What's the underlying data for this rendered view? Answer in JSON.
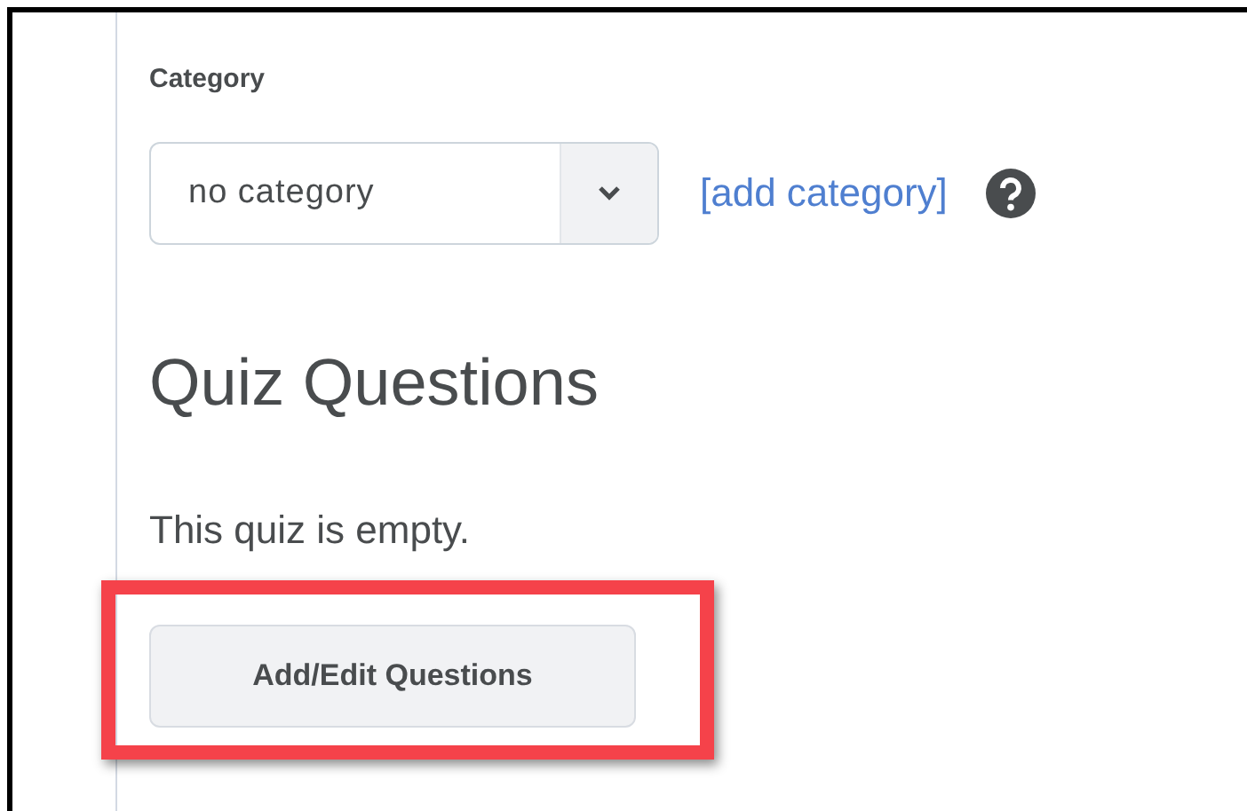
{
  "category": {
    "label": "Category",
    "value": "no category",
    "link": "[add category]"
  },
  "section": {
    "heading": "Quiz Questions",
    "message": "This quiz is empty.",
    "button": {
      "label": "Add/Edit Questions",
      "highlighted": true
    }
  }
}
